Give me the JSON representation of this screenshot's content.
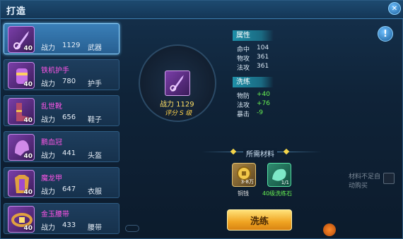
{
  "window": {
    "title": "打造",
    "close_icon": "✕"
  },
  "list": {
    "items": [
      {
        "name": "",
        "level": "40",
        "power_label": "战力",
        "power": "1129",
        "type": "武器",
        "selected": true,
        "icon": "sword-icon"
      },
      {
        "name": "铁机护手",
        "level": "40",
        "power_label": "战力",
        "power": "780",
        "type": "护手",
        "selected": false,
        "icon": "gauntlet-icon"
      },
      {
        "name": "乱世靴",
        "level": "40",
        "power_label": "战力",
        "power": "656",
        "type": "鞋子",
        "selected": false,
        "icon": "boots-icon"
      },
      {
        "name": "鹏血冠",
        "level": "40",
        "power_label": "战力",
        "power": "441",
        "type": "头盔",
        "selected": false,
        "icon": "helmet-icon"
      },
      {
        "name": "魔龙甲",
        "level": "40",
        "power_label": "战力",
        "power": "647",
        "type": "衣服",
        "selected": false,
        "icon": "armor-icon"
      },
      {
        "name": "金玉腰带",
        "level": "40",
        "power_label": "战力",
        "power": "433",
        "type": "腰带",
        "selected": false,
        "icon": "belt-icon"
      }
    ]
  },
  "center": {
    "power": "战力 1129",
    "rating": "评分 S 级"
  },
  "attributes": {
    "title": "属性",
    "rows": [
      {
        "label": "命中",
        "value": "104"
      },
      {
        "label": "物攻",
        "value": "361"
      },
      {
        "label": "法攻",
        "value": "361"
      }
    ]
  },
  "refine": {
    "title": "洗练",
    "rows": [
      {
        "label": "物防",
        "value": "+40"
      },
      {
        "label": "法攻",
        "value": "+76"
      },
      {
        "label": "暴击",
        "value": "-9"
      }
    ]
  },
  "materials": {
    "title": "所需材料",
    "items": [
      {
        "name": "铜钱",
        "qty": "3-8万",
        "icon": "coin-icon"
      },
      {
        "name": "40级洗练石",
        "qty": "1/1",
        "icon": "stone-icon"
      }
    ]
  },
  "auto_buy_label": "材料不足自动购买",
  "wash_button": "洗练",
  "info_icon": "!",
  "colors": {
    "item_name": "#ff55e8",
    "bonus": "#67f052",
    "button": "#f0a422"
  }
}
